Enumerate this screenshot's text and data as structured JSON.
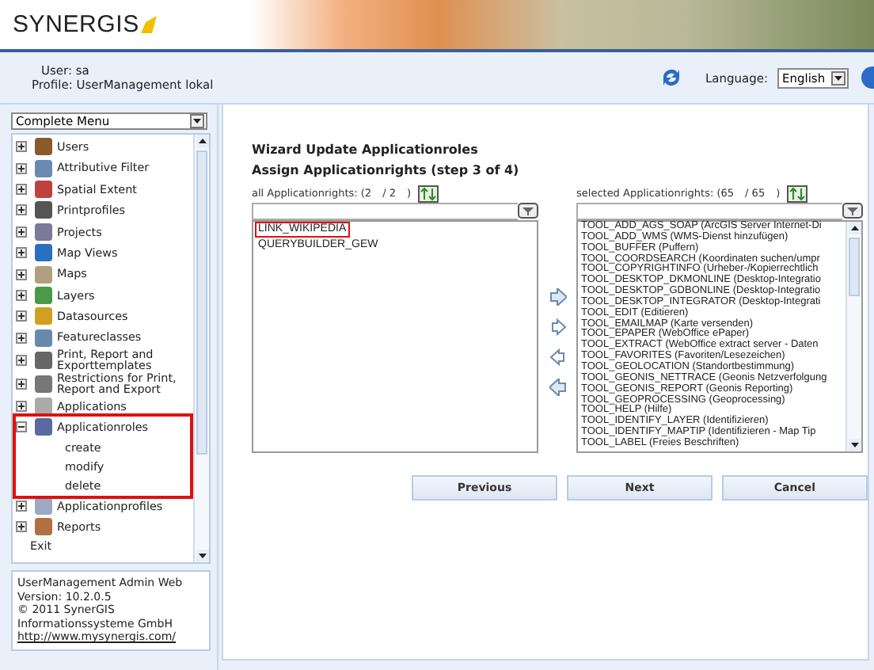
{
  "header": {
    "logo": "SYNERGIS"
  },
  "user_bar": {
    "user": "User: sa",
    "profile": "Profile: UserManagement lokal",
    "language_label": "Language:",
    "language": "English"
  },
  "sidebar": {
    "menu_select": "Complete Menu",
    "items": [
      {
        "label": "Users",
        "expanded": false,
        "highlighted": false
      },
      {
        "label": "Attributive Filter",
        "expanded": false,
        "highlighted": false
      },
      {
        "label": "Spatial Extent",
        "expanded": false,
        "highlighted": false
      },
      {
        "label": "Printprofiles",
        "expanded": false,
        "highlighted": false
      },
      {
        "label": "Projects",
        "expanded": false,
        "highlighted": false
      },
      {
        "label": "Map Views",
        "expanded": false,
        "highlighted": false
      },
      {
        "label": "Maps",
        "expanded": false,
        "highlighted": false
      },
      {
        "label": "Layers",
        "expanded": false,
        "highlighted": false
      },
      {
        "label": "Datasources",
        "expanded": false,
        "highlighted": false
      },
      {
        "label": "Featureclasses",
        "expanded": false,
        "highlighted": false
      },
      {
        "label": "Print, Report and Exporttemplates",
        "expanded": false,
        "highlighted": false
      },
      {
        "label": "Restrictions for Print, Report and Export",
        "expanded": false,
        "highlighted": false
      },
      {
        "label": "Applications",
        "expanded": false,
        "highlighted": false
      },
      {
        "label": "Applicationroles",
        "expanded": true,
        "highlighted": true,
        "children": [
          {
            "label": "create"
          },
          {
            "label": "modify"
          },
          {
            "label": "delete"
          }
        ]
      },
      {
        "label": "Applicationprofiles",
        "expanded": false,
        "highlighted": false
      },
      {
        "label": "Reports",
        "expanded": false,
        "highlighted": false
      }
    ],
    "exit": "Exit",
    "footer": {
      "lines": [
        "UserManagement Admin Web",
        "Version: 10.2.0.5",
        "© 2011 SynerGIS",
        "Informationssysteme GmbH"
      ],
      "link": "http://www.mysynergis.com/"
    }
  },
  "wizard": {
    "title": "Wizard Update Applicationroles",
    "subtitle": "Assign Applicationrights (step 3 of 4)",
    "available": {
      "label": "all Applicationrights: (2",
      "count_sep": "/ 2",
      "close": ")",
      "items": [
        {
          "label": "LINK_WIKIPEDIA",
          "highlighted": true
        },
        {
          "label": "QUERYBUILDER_GEW",
          "highlighted": false
        }
      ]
    },
    "selected": {
      "label": "selected Applicationrights: (65",
      "count_sep": "/ 65",
      "close": ")",
      "items": [
        {
          "label": "TOOL_ADD_AGS_SOAP (ArcGIS Server Internet-Di"
        },
        {
          "label": "TOOL_ADD_WMS (WMS-Dienst hinzufügen)"
        },
        {
          "label": "TOOL_BUFFER (Puffern)"
        },
        {
          "label": "TOOL_COORDSEARCH (Koordinaten suchen/umpr"
        },
        {
          "label": "TOOL_COPYRIGHTINFO (Urheber-/Kopierrechtlich"
        },
        {
          "label": "TOOL_DESKTOP_DKMONLINE (Desktop-Integratio"
        },
        {
          "label": "TOOL_DESKTOP_GDBONLINE (Desktop-Integratio"
        },
        {
          "label": "TOOL_DESKTOP_INTEGRATOR (Desktop-Integrati"
        },
        {
          "label": "TOOL_EDIT (Editieren)"
        },
        {
          "label": "TOOL_EMAILMAP (Karte versenden)"
        },
        {
          "label": "TOOL_EPAPER (WebOffice ePaper)"
        },
        {
          "label": "TOOL_EXTRACT (WebOffice extract server - Daten"
        },
        {
          "label": "TOOL_FAVORITES (Favoriten/Lesezeichen)"
        },
        {
          "label": "TOOL_GEOLOCATION (Standortbestimmung)"
        },
        {
          "label": "TOOL_GEONIS_NETTRACE (Geonis Netzverfolgung"
        },
        {
          "label": "TOOL_GEONIS_REPORT (Geonis Reporting)"
        },
        {
          "label": "TOOL_GEOPROCESSING (Geoprocessing)"
        },
        {
          "label": "TOOL_HELP (Hilfe)"
        },
        {
          "label": "TOOL_IDENTIFY_LAYER (Identifizieren)"
        },
        {
          "label": "TOOL_IDENTIFY_MAPTIP (Identifizieren - Map Tip"
        },
        {
          "label": "TOOL_LABEL (Freies Beschriften)"
        }
      ]
    },
    "buttons": [
      "Previous",
      "Next",
      "Cancel"
    ]
  }
}
